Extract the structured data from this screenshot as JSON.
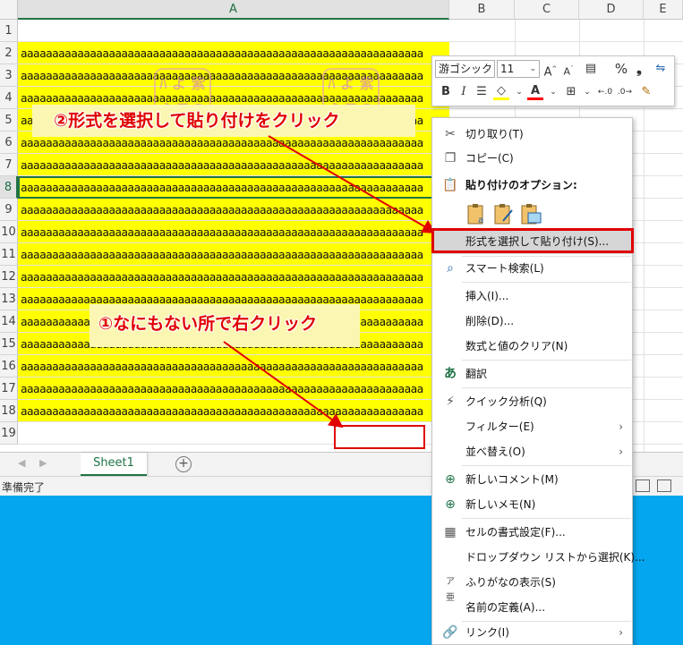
{
  "columns": [
    "A",
    "B",
    "C",
    "D",
    "E"
  ],
  "rows": [
    "1",
    "2",
    "3",
    "4",
    "5",
    "6",
    "7",
    "8",
    "9",
    "10",
    "11",
    "12",
    "13",
    "14",
    "15",
    "16",
    "17",
    "18",
    "19"
  ],
  "cell_text": "aaaaaaaaaaaaaaaaaaaaaaaaaaaaaaaaaaaaaaaaaaaaaaaaaaaaaaaaaaaaaaaa",
  "colors": {
    "fill_yellow": "#ffff00",
    "excel_green": "#217346",
    "annotation_red": "#e00000",
    "desktop_blue": "#04a6ef"
  },
  "sheet_tab": "Sheet1",
  "status": "準備完了",
  "annotations": {
    "step1": "①なにもない所で右クリック",
    "step2": "②形式を選択して貼り付けをクリック"
  },
  "minibar": {
    "font": "游ゴシック",
    "size": "11",
    "grow": "A",
    "shrink": "A",
    "percent": "%",
    "comma": "❟",
    "bold": "B",
    "italic": "I"
  },
  "menu": {
    "cut": "切り取り(T)",
    "copy": "コピー(C)",
    "paste_options": "貼り付けのオプション:",
    "paste_special": "形式を選択して貼り付け(S)...",
    "smart_lookup": "スマート検索(L)",
    "insert": "挿入(I)...",
    "delete": "削除(D)...",
    "clear": "数式と値のクリア(N)",
    "translate": "翻訳",
    "quick_analysis": "クイック分析(Q)",
    "filter": "フィルター(E)",
    "sort": "並べ替え(O)",
    "new_comment": "新しいコメント(M)",
    "new_note": "新しいメモ(N)",
    "format_cells": "セルの書式設定(F)...",
    "dropdown_pick": "ドロップダウン リストから選択(K)...",
    "phonetic": "ふりがなの表示(S)",
    "define_name": "名前の定義(A)...",
    "link": "リンク(I)",
    "submenu_arrow": "›"
  }
}
